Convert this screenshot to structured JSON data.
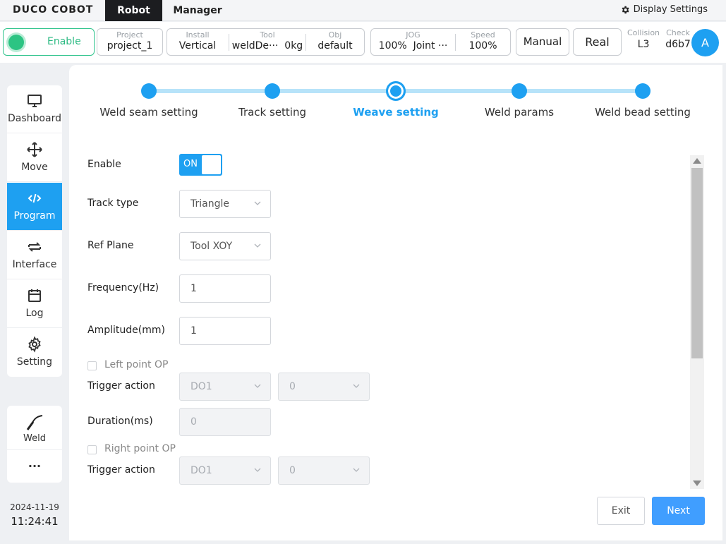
{
  "topnav": {
    "logo": "DUCO COBOT",
    "tabs": [
      {
        "label": "Robot"
      },
      {
        "label": "Manager"
      }
    ],
    "display_settings": "Display Settings"
  },
  "status": {
    "enable": "Enable",
    "project": {
      "label": "Project",
      "value": "project_1"
    },
    "install": {
      "label": "Install",
      "value": "Vertical"
    },
    "tool": {
      "label": "Tool",
      "value": "weldDe···",
      "weight": "0kg"
    },
    "obj": {
      "label": "Obj",
      "value": "default"
    },
    "jog": {
      "label": "JOG",
      "value": "100%",
      "mode": "Joint ···"
    },
    "speed": {
      "label": "Speed",
      "value": "100%"
    },
    "manual": "Manual",
    "real": "Real",
    "collision": {
      "label": "Collision",
      "value": "L3"
    },
    "check": {
      "label": "Check",
      "value": "d6b7"
    },
    "avatar": "A"
  },
  "sidebar": {
    "items": [
      {
        "label": "Dashboard",
        "icon": "monitor-icon"
      },
      {
        "label": "Move",
        "icon": "move-arrows-icon"
      },
      {
        "label": "Program",
        "icon": "code-icon"
      },
      {
        "label": "Interface",
        "icon": "swap-icon"
      },
      {
        "label": "Log",
        "icon": "calendar-icon"
      },
      {
        "label": "Setting",
        "icon": "gear-icon"
      }
    ],
    "active_index": 2,
    "weld": {
      "label": "Weld",
      "icon": "weld-torch-icon"
    },
    "more": "···"
  },
  "datetime": {
    "date": "2024-11-19",
    "time": "11:24:41"
  },
  "steps": {
    "items": [
      {
        "label": "Weld seam setting"
      },
      {
        "label": "Track setting"
      },
      {
        "label": "Weave setting"
      },
      {
        "label": "Weld params"
      },
      {
        "label": "Weld bead setting"
      }
    ],
    "current_index": 2
  },
  "form": {
    "enable": {
      "label": "Enable",
      "toggle_text": "ON",
      "on": true
    },
    "track_type": {
      "label": "Track type",
      "value": "Triangle"
    },
    "ref_plane": {
      "label": "Ref Plane",
      "value": "Tool XOY"
    },
    "frequency": {
      "label": "Frequency(Hz)",
      "value": "1"
    },
    "amplitude": {
      "label": "Amplitude(mm)",
      "value": "1"
    },
    "left_point_op": {
      "label": "Left point OP",
      "checked": false
    },
    "trigger_action_1": {
      "label": "Trigger action",
      "port": "DO1",
      "value": "0"
    },
    "duration": {
      "label": "Duration(ms)",
      "value": "0"
    },
    "right_point_op": {
      "label": "Right point OP",
      "checked": false
    },
    "trigger_action_2": {
      "label": "Trigger action",
      "port": "DO1",
      "value": "0"
    }
  },
  "buttons": {
    "exit": "Exit",
    "next": "Next"
  },
  "colors": {
    "accent": "#1ea0f1",
    "enable_green": "#2cc483",
    "next_button": "#409eff"
  }
}
